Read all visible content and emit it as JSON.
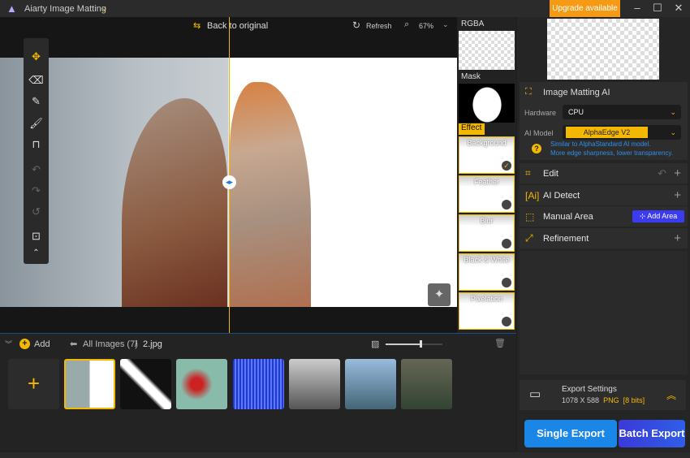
{
  "app": {
    "title": "Aiarty Image Matting",
    "upgrade": "Upgrade available"
  },
  "toolbar": {
    "back": "Back to original",
    "refresh": "Refresh",
    "zoom": "67%"
  },
  "strip": {
    "rgba": "RGBA",
    "mask": "Mask",
    "effect": "Effect",
    "effects": [
      {
        "label": "Background",
        "selected": true
      },
      {
        "label": "Feather",
        "selected": false
      },
      {
        "label": "Blur",
        "selected": false
      },
      {
        "label": "Black & White",
        "selected": false
      },
      {
        "label": "Pixelation",
        "selected": false
      }
    ]
  },
  "panel": {
    "matting": "Image Matting AI",
    "hardware_label": "Hardware",
    "hardware": "CPU",
    "model_label": "AI Model",
    "model": "AlphaEdge  V2",
    "hint1": "Similar to AlphaStandard AI model.",
    "hint2": "More edge sharpness, lower transparency.",
    "edit": "Edit",
    "detect": "AI Detect",
    "manual": "Manual Area",
    "add_area": "Add Area",
    "refinement": "Refinement"
  },
  "export": {
    "title": "Export Settings",
    "size": "1078 X 588",
    "format": "PNG",
    "bits": "[8 bits]",
    "single": "Single Export",
    "batch": "Batch Export"
  },
  "gallery": {
    "add": "Add",
    "all": "All Images (7)",
    "sep": "/",
    "file": "2.jpg",
    "zoom_level": 0.6
  },
  "colors": {
    "accent": "#f5b800",
    "upgrade": "#f59a12",
    "single": "#1a86e8",
    "batch": "#3a3ad8"
  }
}
